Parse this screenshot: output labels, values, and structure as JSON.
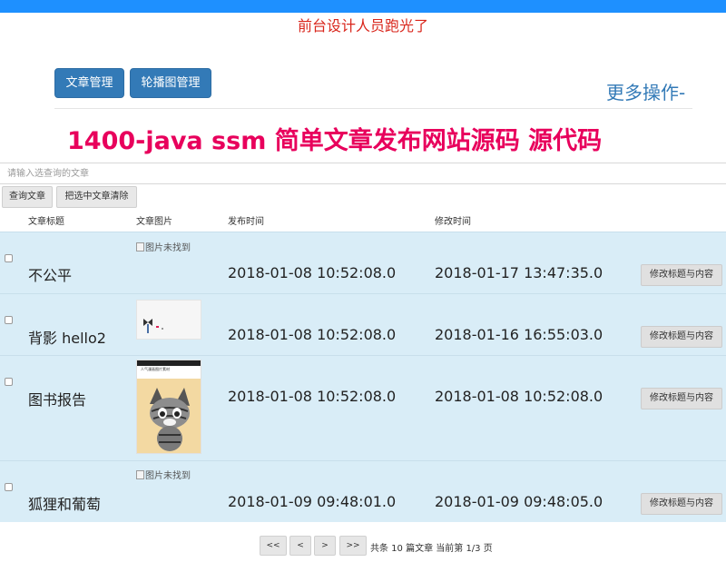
{
  "header": {
    "notice": "前台设计人员跑光了",
    "more_ops": "更多操作-"
  },
  "nav": {
    "article_mgmt": "文章管理",
    "carousel_mgmt": "轮播图管理"
  },
  "banner": "1400-java ssm 简单文章发布网站源码 源代码",
  "search": {
    "placeholder": "请输入选查询的文章",
    "query_button": "查询文章",
    "clear_button": "把选中文章清除"
  },
  "table": {
    "columns": [
      "文章标题",
      "文章图片",
      "发布时间",
      "修改时间"
    ],
    "edit_label": "修改标题与内容",
    "broken_image_text": "图片未找到",
    "rows": [
      {
        "title": "不公平",
        "image": "broken",
        "published": "2018-01-08 10:52:08.0",
        "modified": "2018-01-17 13:47:35.0"
      },
      {
        "title": "背影 hello2",
        "image": "cartoon",
        "published": "2018-01-08 10:52:08.0",
        "modified": "2018-01-16 16:55:03.0"
      },
      {
        "title": "图书报告",
        "image": "cat",
        "image_caption": "人气漫画图片素材",
        "published": "2018-01-08 10:52:08.0",
        "modified": "2018-01-08 10:52:08.0"
      },
      {
        "title": "狐狸和葡萄",
        "image": "broken",
        "published": "2018-01-09 09:48:01.0",
        "modified": "2018-01-09 09:48:05.0"
      }
    ]
  },
  "pagination": {
    "first": "<<",
    "prev": "<",
    "next": ">",
    "last": ">>",
    "info": "共条 10 篇文章 当前第 1/3 页"
  },
  "colors": {
    "accent": "#1e90ff",
    "nav_button": "#337ab7",
    "banner": "#e8005c",
    "notice": "#d9261c",
    "row_bg": "#d9edf7"
  }
}
